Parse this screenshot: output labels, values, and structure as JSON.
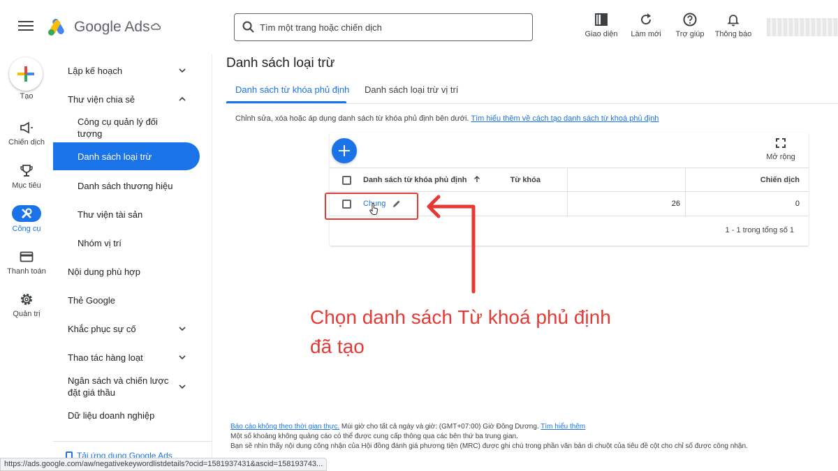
{
  "app": {
    "brand": "Google Ads"
  },
  "search": {
    "placeholder": "Tìm một trang hoặc chiến dịch"
  },
  "top_buttons": [
    {
      "label": "Giao diện",
      "icon": "appearance-icon"
    },
    {
      "label": "Làm mới",
      "icon": "refresh-icon"
    },
    {
      "label": "Trợ giúp",
      "icon": "help-icon"
    },
    {
      "label": "Thông báo",
      "icon": "bell-icon"
    }
  ],
  "rail": {
    "create_label": "Tạo",
    "items": [
      {
        "label": "Chiến dịch",
        "icon": "megaphone-icon"
      },
      {
        "label": "Mục tiêu",
        "icon": "trophy-icon"
      },
      {
        "label": "Công cụ",
        "icon": "tools-icon",
        "active": true
      },
      {
        "label": "Thanh toán",
        "icon": "credit-card-icon"
      },
      {
        "label": "Quản trị",
        "icon": "gear-icon"
      }
    ]
  },
  "nav": {
    "items": [
      {
        "label": "Lập kế hoạch"
      },
      {
        "label": "Thư viện chia sẻ"
      },
      {
        "label": "Công cụ quản lý đối tượng"
      },
      {
        "label": "Danh sách loại trừ"
      },
      {
        "label": "Danh sách thương hiệu"
      },
      {
        "label": "Thư viện tài sản"
      },
      {
        "label": "Nhóm vị trí"
      },
      {
        "label": "Nội dung phù hợp"
      },
      {
        "label": "Thẻ Google"
      },
      {
        "label": "Khắc phục sự cố"
      },
      {
        "label": "Thao tác hàng loạt"
      },
      {
        "label": "Ngân sách và chiến lược đặt giá thầu"
      },
      {
        "label": "Dữ liệu doanh nghiệp"
      }
    ],
    "app_link": "Tải ứng dụng Google Ads"
  },
  "main": {
    "title": "Danh sách loại trừ",
    "tabs": [
      {
        "label": "Danh sách từ khóa phủ định"
      },
      {
        "label": "Danh sách loại trừ vị trí"
      }
    ],
    "description": "Chỉnh sửa, xóa hoặc áp dụng danh sách từ khóa phủ định bên dưới.",
    "description_link": "Tìm hiểu thêm về cách tạo danh sách từ khoá phủ định",
    "expand_label": "Mở rộng",
    "table": {
      "columns": [
        "Danh sách từ khóa phủ định",
        "Từ khóa",
        "Chiến dịch"
      ],
      "rows": [
        {
          "name": "Chung",
          "keywords": "26",
          "campaigns": "0"
        }
      ],
      "pagination": "1 - 1 trong tổng số 1"
    }
  },
  "annotation": "Chọn danh sách Từ khoá phủ định đã tạo",
  "footer": {
    "line1_link": "Báo cáo không theo thời gian thực.",
    "line1_text": " Múi giờ cho tất cả ngày và giờ: (GMT+07:00) Giờ Đông Dương.",
    "line1_link2": "Tìm hiểu thêm",
    "line2": "Một số khoảng không quảng cáo có thể được cung cấp thông qua các bên thứ ba trung gian.",
    "line3": "Bạn sẽ nhìn thấy nội dung công nhận của Hội đồng đánh giá phương tiện (MRC) được ghi chú trong phần văn bản di chuột của tiêu đề cột cho chỉ số được công nhận."
  },
  "statusbar_url": "https://ads.google.com/aw/negativekeywordlistdetails?ocid=1581937431&ascid=158193743...",
  "colors": {
    "accent": "#1a73e8",
    "annotation": "#e53935"
  }
}
